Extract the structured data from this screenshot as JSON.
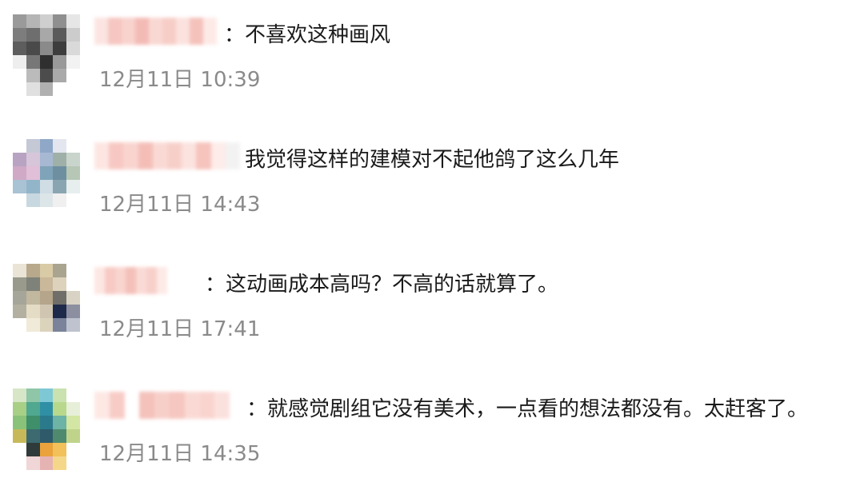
{
  "comments": [
    {
      "text": "：不喜欢这种画风",
      "time": "12月11日 10:39",
      "avatar_palette": [
        "#9a9a9a",
        "#b5b5b5",
        "#cfcfcf",
        "#8f8f8f",
        "#e6e6e6",
        "#7d7d7d",
        "#6e6e6e",
        "#a8a8a8",
        "#5a5a5a",
        "#cccccc",
        "#5d5d5d",
        "#4a4a4a",
        "#8a8a8a",
        "#3d3d3d",
        "#d9d9d9",
        "#eeeeee",
        "#777777",
        "#2f2f2f",
        "#999999",
        "#f2f2f2",
        "#ffffff",
        "#bbbbbb",
        "#4c4c4c",
        "#aaaaaa",
        "#ffffff",
        "#ffffff",
        "#e0e0e0",
        "#b0b0b0",
        "#ffffff",
        "#ffffff"
      ],
      "username_palette": [
        "#fbe3e0",
        "#f6c4bf",
        "#f8d0cb",
        "#f3b8b2",
        "#f9d6d1",
        "#f7cbc5",
        "#fbe1dd",
        "#f5bfb8",
        "#fde9e6",
        "#ffffff"
      ]
    },
    {
      "text": "我觉得这样的建模对不起他鸽了这么几年",
      "time": "12月11日 14:43",
      "avatar_palette": [
        "#ffffff",
        "#c5c9d6",
        "#8fa8c8",
        "#e3e6ee",
        "#ffffff",
        "#b8a3c2",
        "#d7c5d9",
        "#a7b8d3",
        "#9fb0a8",
        "#c9d4cc",
        "#cfa9c6",
        "#e2bfd8",
        "#7fa3b8",
        "#6e8fa0",
        "#b6c7b5",
        "#a9c2d4",
        "#93b5c9",
        "#d0dde5",
        "#8aa5b2",
        "#e6eeee",
        "#ffffff",
        "#c8d8e0",
        "#dce6e8",
        "#f0f0f0",
        "#ffffff",
        "#ffffff",
        "#ffffff",
        "#ffffff",
        "#ffffff",
        "#ffffff"
      ],
      "username_palette": [
        "#fde5e1",
        "#f7c6c0",
        "#f9d2cd",
        "#f4bbb4",
        "#fad8d3",
        "#f7cdc7",
        "#fbe2de",
        "#f6c1ba",
        "#fdebe8",
        "#f2f2f2"
      ]
    },
    {
      "text": "：这动画成本高吗？不高的话就算了。",
      "time": "12月11日 17:41",
      "avatar_palette": [
        "#e9e4d6",
        "#b8a98c",
        "#d9cba6",
        "#a9a48f",
        "#ffffff",
        "#9a9a8c",
        "#7f8278",
        "#c9b89a",
        "#ddd2bb",
        "#ffffff",
        "#a6a59a",
        "#c2b79f",
        "#b5a58a",
        "#6f6e68",
        "#d8d3c4",
        "#b4b0a1",
        "#e5dcc5",
        "#cfc5b0",
        "#1e2a4a",
        "#8b8fa0",
        "#ffffff",
        "#f0ead8",
        "#dcd3bd",
        "#7a8399",
        "#bfc3cf",
        "#ffffff",
        "#ffffff",
        "#ffffff",
        "#ffffff",
        "#ffffff"
      ],
      "username_palette": [
        "#fde6e2",
        "#f7c8c2",
        "#f9d3ce",
        "#f4bdb6",
        "#fad9d4",
        "#f7cec8",
        "#fde9e6",
        "#ffffff",
        "#ffffff",
        "#ffffff"
      ]
    },
    {
      "text": "：就感觉剧组它没有美术，一点看的想法都没有。太赶客了。",
      "time": "12月11日 14:35",
      "avatar_palette": [
        "#d6e6c6",
        "#8fc6a8",
        "#7ec8d6",
        "#c9e2b0",
        "#ffffff",
        "#a7cf86",
        "#4fa88f",
        "#2f8fa5",
        "#b8d98c",
        "#e7efd9",
        "#8ac27a",
        "#3f8f6a",
        "#2a7a8c",
        "#6db3a6",
        "#d4e6a3",
        "#c7b95a",
        "#3c6a70",
        "#2e5a6a",
        "#4f8a6f",
        "#bfd48a",
        "#ffffff",
        "#2f3a3a",
        "#e9a23c",
        "#f2c15a",
        "#ffffff",
        "#ffffff",
        "#f0d6d6",
        "#e6b3b3",
        "#f5d78a",
        "#ffffff"
      ],
      "username_palette": [
        "#fde7e3",
        "#f8cac4",
        "#ffffff",
        "#f4bfb8",
        "#f7cdc7",
        "#f6c4bd",
        "#fad8d3",
        "#f9d2cd",
        "#fbe0dc",
        "#ffffff"
      ]
    }
  ]
}
